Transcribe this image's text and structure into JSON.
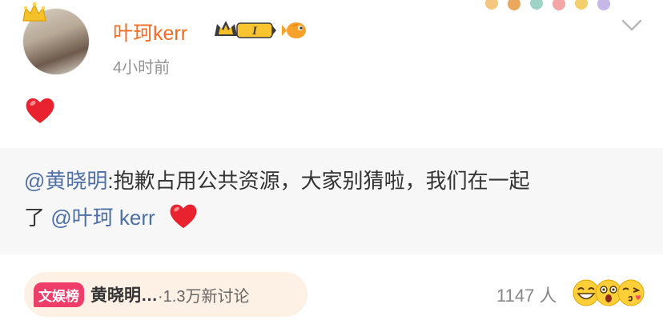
{
  "post": {
    "user_name": "叶珂kerr",
    "vip_level": "I",
    "time": "4小时前",
    "reaction_emoji": "red-heart"
  },
  "repost": {
    "mention_author": "@黄晓明",
    "text": ":抱歉占用公共资源，大家别猜啦，我们在一起",
    "text_tail": "了",
    "mention_target": "@叶珂 kerr"
  },
  "footer": {
    "topic_tag": "文娱榜",
    "topic_title": "黄晓明…",
    "topic_count": "·1.3万新讨论",
    "reaction_count": "1147 人"
  },
  "colors": {
    "user_name": "#f36c21",
    "mention": "#4e6fa6",
    "topic_tag_bg": "#ee3d69",
    "repost_bg": "#f7f7f7"
  }
}
